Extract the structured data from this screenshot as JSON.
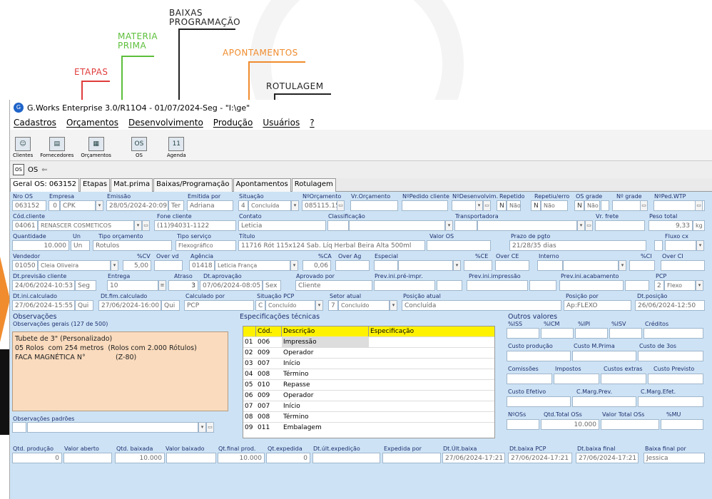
{
  "callouts": {
    "etapas": "ETAPAS",
    "materia_prima": "MATERIA\nPRIMA",
    "baixas_programacao": "BAIXAS\nPROGRAMAÇÃO",
    "apontamentos": "APONTAMENTOS",
    "rotulagem": "ROTULAGEM",
    "colors": {
      "etapas": "#e03c3c",
      "materia_prima": "#5cbf3a",
      "apontamentos": "#f08c2e",
      "dark": "#222222"
    }
  },
  "window": {
    "title": "G.Works Enterprise 3.0/R11O4 - 01/07/2024-Seg - \"I:\\ge\""
  },
  "menu": [
    "Cadastros",
    "Orçamentos",
    "Desenvolvimento",
    "Produção",
    "Usuários",
    "?"
  ],
  "toolbar": [
    {
      "label": "Clientes",
      "icon": "clients-icon"
    },
    {
      "label": "Fornecedores",
      "icon": "suppliers-icon"
    },
    {
      "label": "Orçamentos",
      "icon": "calculator-icon"
    },
    {
      "label": "OS",
      "icon": "os-clipboard-icon"
    },
    {
      "label": "Agenda",
      "icon": "calendar-icon"
    }
  ],
  "os_tab": {
    "label": "OS",
    "arrow": "⇐"
  },
  "tabs": [
    "Geral OS: 063152",
    "Etapas",
    "Mat.prima",
    "Baixas/Programação",
    "Apontamentos",
    "Rotulagem"
  ],
  "form": {
    "nro_os": {
      "label": "Nro OS",
      "value": "063152"
    },
    "empresa": {
      "label": "Empresa",
      "code": "0",
      "value": "CPK"
    },
    "emissao": {
      "label": "Emissão",
      "value": "28/05/2024-20:09",
      "day": "Ter"
    },
    "emitida_por": {
      "label": "Emitida por",
      "value": "Adriana"
    },
    "situacao": {
      "label": "Situação",
      "code": "4",
      "value": "Concluída"
    },
    "n_orcamento": {
      "label": "NºOrçamento",
      "value": "085115.15"
    },
    "vr_orcamento": {
      "label": "Vr.Orçamento",
      "value": ""
    },
    "n_pedido": {
      "label": "NºPedido cliente",
      "value": ""
    },
    "n_desenvolvim": {
      "label": "NºDesenvolvim.",
      "value": ""
    },
    "repetido": {
      "label": "Repetido",
      "flag": "N",
      "value": "Não"
    },
    "repetiu_erro": {
      "label": "Repetiu/erro",
      "flag": "N",
      "value": "Não"
    },
    "os_grade": {
      "label": "OS grade",
      "flag": "N",
      "value": "Não"
    },
    "n_grade": {
      "label": "Nº grade",
      "value": ""
    },
    "n_ped_wtp": {
      "label": "NºPed.WTP",
      "value": ""
    },
    "cod_cliente": {
      "label": "Cód.cliente",
      "code": "04061",
      "value": "RENASCER COSMETICOS"
    },
    "fone": {
      "label": "Fone cliente",
      "value": "(11)94031-1122"
    },
    "contato": {
      "label": "Contato",
      "value": "Leticia"
    },
    "classificacao": {
      "label": "Classificação",
      "value": ""
    },
    "transportadora": {
      "label": "Transportadora",
      "value": ""
    },
    "vr_frete": {
      "label": "Vr. frete",
      "value": ""
    },
    "peso_total": {
      "label": "Peso total",
      "value": "9,33",
      "unit": "kg"
    },
    "quantidade": {
      "label": "Quantidade",
      "value": "10.000"
    },
    "un": {
      "label": "Un",
      "value": "Un"
    },
    "tipo_orcamento": {
      "label": "Tipo orçamento",
      "value": "Rotulos"
    },
    "tipo_servico": {
      "label": "Tipo serviço",
      "value": "Flexográfico"
    },
    "titulo": {
      "label": "Título",
      "value": "11716 Rót 115x124 Sab. Líq Herbal Beira Alta 500ml"
    },
    "valor_os": {
      "label": "Valor OS",
      "value": ""
    },
    "prazo_pgto": {
      "label": "Prazo de pgto",
      "value": "21/28/35 dias"
    },
    "fluxo_cx": {
      "label": "Fluxo cx",
      "value": ""
    },
    "vendedor": {
      "label": "Vendedor",
      "code": "01050",
      "value": "Cleia Oliveira"
    },
    "pct_cv": {
      "label": "%CV",
      "value": "5,00"
    },
    "over_vd": {
      "label": "Over vd",
      "value": ""
    },
    "agencia": {
      "label": "Agência",
      "code": "01418",
      "value": "Leticia França"
    },
    "pct_ca": {
      "label": "%CA",
      "value": "0,06"
    },
    "over_ag": {
      "label": "Over Ag",
      "value": ""
    },
    "especial": {
      "label": "Especial",
      "value": ""
    },
    "pct_ce": {
      "label": "%CE",
      "value": ""
    },
    "over_ce": {
      "label": "Over CE",
      "value": ""
    },
    "interno": {
      "label": "Interno",
      "value": ""
    },
    "pct_ci": {
      "label": "%CI",
      "value": ""
    },
    "over_ci": {
      "label": "Over CI",
      "value": ""
    },
    "dt_previsao": {
      "label": "Dt.previsão cliente",
      "value": "24/06/2024-10:53",
      "day": "Seg"
    },
    "entrega": {
      "label": "Entrega",
      "value": "10"
    },
    "atraso": {
      "label": "Atraso",
      "value": "3"
    },
    "dt_aprovacao": {
      "label": "Dt.aprovação",
      "value": "07/06/2024-08:05",
      "day": "Sex"
    },
    "aprovado_por": {
      "label": "Aprovado por",
      "value": "Cliente"
    },
    "prev_pre_impr": {
      "label": "Prev.ini.pré-impr.",
      "value": ""
    },
    "prev_impressao": {
      "label": "Prev.ini.impressão",
      "value": ""
    },
    "prev_acabamento": {
      "label": "Prev.ini.acabamento",
      "value": ""
    },
    "pcp": {
      "label": "PCP",
      "code": "2",
      "value": "Flexo"
    },
    "dt_ini_calc": {
      "label": "Dt.ini.calculado",
      "value": "27/06/2024-15:55",
      "day": "Qui"
    },
    "dt_fim_calc": {
      "label": "Dt.fim.calculado",
      "value": "27/06/2024-16:00",
      "day": "Qui"
    },
    "calculado_por": {
      "label": "Calculado por",
      "value": "PCP"
    },
    "situacao_pcp": {
      "label": "Situação PCP",
      "code": "C",
      "value": "Concluído"
    },
    "setor_atual": {
      "label": "Setor atual",
      "code": "7",
      "value": "Concluído"
    },
    "posicao_atual": {
      "label": "Posição atual",
      "value": "Concluída"
    },
    "posicao_por": {
      "label": "Posição por",
      "value": "Ap:FLEXO"
    },
    "dt_posicao": {
      "label": "Dt.posição",
      "value": "26/06/2024-12:50"
    }
  },
  "observacoes": {
    "title": "Observações",
    "subtitle": "Observações gerais (127 de 500)",
    "lines": [
      "Tubete de 3\" (Personalizado)",
      "05 Rolos  com 254 metros  (Rolos com 2.000 Rótulos)",
      "",
      "FACA MAGNÉTICA N°              (Z-80)"
    ],
    "padroes_label": "Observações padrões"
  },
  "especificacoes": {
    "title": "Especificações técnicas",
    "headers": [
      "Cód.",
      "Descrição",
      "Especificação"
    ],
    "rows": [
      {
        "n": "01",
        "cod": "006",
        "desc": "Impressão"
      },
      {
        "n": "02",
        "cod": "009",
        "desc": "Operador"
      },
      {
        "n": "03",
        "cod": "007",
        "desc": "Início"
      },
      {
        "n": "04",
        "cod": "008",
        "desc": "Término"
      },
      {
        "n": "05",
        "cod": "010",
        "desc": "Repasse"
      },
      {
        "n": "06",
        "cod": "009",
        "desc": "Operador"
      },
      {
        "n": "07",
        "cod": "007",
        "desc": "Início"
      },
      {
        "n": "08",
        "cod": "008",
        "desc": "Término"
      },
      {
        "n": "09",
        "cod": "011",
        "desc": "Embalagem"
      }
    ]
  },
  "outros": {
    "title": "Outros valores",
    "row1": [
      "%ISS",
      "%ICM",
      "%IPI",
      "%ISV",
      "Créditos"
    ],
    "row2": [
      "Custo produção",
      "Custo M.Prima",
      "Custo de 3os"
    ],
    "row3": [
      "Comissões",
      "Impostos",
      "Custos extras",
      "Custo Previsto"
    ],
    "row4": [
      "Custo Efetivo",
      "C.Marg.Prev.",
      "C.Marg.Efet."
    ],
    "row5": [
      "NºOSs",
      "Qtd.Total OSs",
      "Valor Total OSs",
      "%MU"
    ],
    "qtd_total": "10.000"
  },
  "bottom": [
    {
      "label": "Qtd. produção",
      "value": "0"
    },
    {
      "label": "Valor aberto",
      "value": ""
    },
    {
      "label": "Qtd. baixada",
      "value": "10.000"
    },
    {
      "label": "Valor baixado",
      "value": ""
    },
    {
      "label": "Qt.final prod.",
      "value": "10.000"
    },
    {
      "label": "Qt.expedida",
      "value": "0"
    },
    {
      "label": "Dt.últ.expedição",
      "value": ""
    },
    {
      "label": "Expedida por",
      "value": ""
    },
    {
      "label": "Dt.Últ.baixa",
      "value": "27/06/2024-17:21"
    },
    {
      "label": "Dt.baixa PCP",
      "value": "27/06/2024-17:21"
    },
    {
      "label": "Dt.baixa final",
      "value": "27/06/2024-17:21"
    },
    {
      "label": "Baixa final por",
      "value": "Jessica"
    }
  ]
}
